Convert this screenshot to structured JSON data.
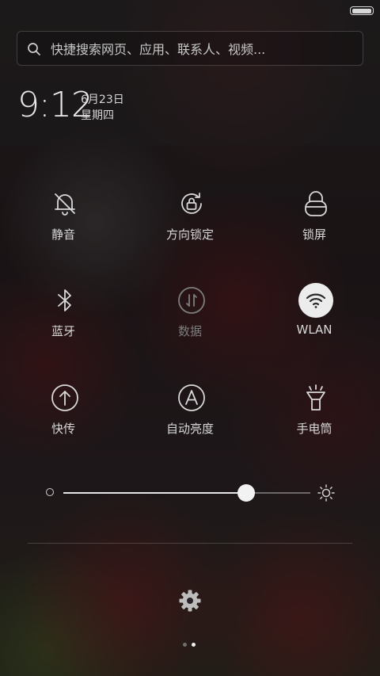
{
  "search": {
    "placeholder": "快捷搜索网页、应用、联系人、视频..."
  },
  "clock": {
    "time": "9:12",
    "date": "6月23日",
    "weekday": "星期四"
  },
  "toggles": [
    {
      "label": "静音",
      "icon": "bell-off-icon"
    },
    {
      "label": "方向锁定",
      "icon": "rotation-lock-icon"
    },
    {
      "label": "锁屏",
      "icon": "lock-icon"
    },
    {
      "label": "蓝牙",
      "icon": "bluetooth-icon"
    },
    {
      "label": "数据",
      "icon": "mobile-data-icon"
    },
    {
      "label": "WLAN",
      "icon": "wifi-icon"
    },
    {
      "label": "快传",
      "icon": "share-transfer-icon"
    },
    {
      "label": "自动亮度",
      "icon": "auto-brightness-icon"
    },
    {
      "label": "手电筒",
      "icon": "flashlight-icon"
    }
  ],
  "brightness": {
    "level": 0.74
  },
  "pager": {
    "pages": 2,
    "current": 2
  },
  "colors": {
    "accent": "#ececec",
    "text": "#d8d8d8",
    "disabled": "#7d7d7d"
  }
}
